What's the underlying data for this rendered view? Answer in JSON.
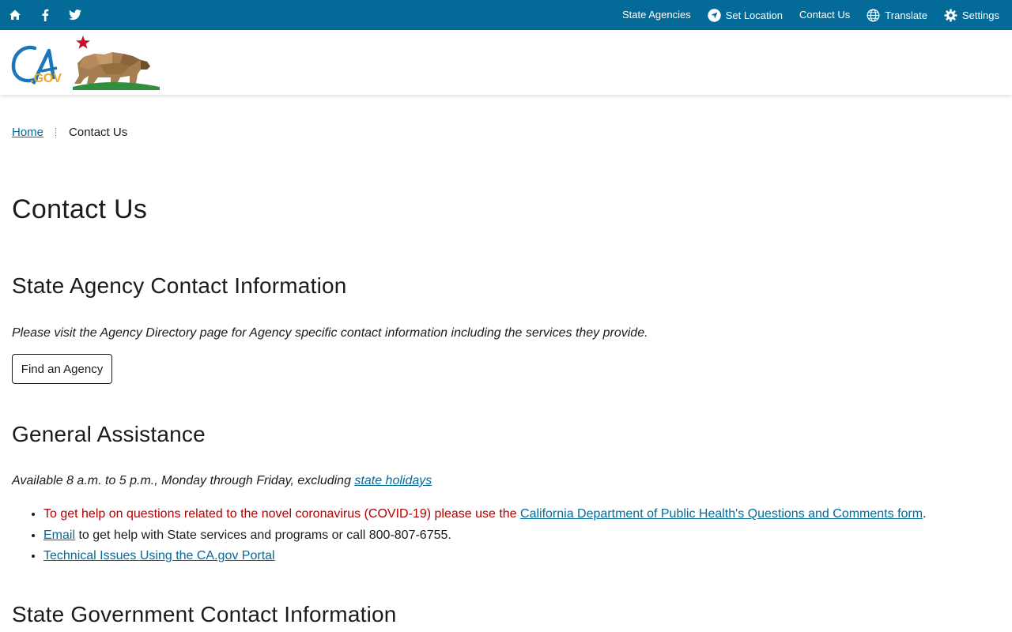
{
  "utility": {
    "icons": [
      "home-icon",
      "facebook-icon",
      "twitter-icon"
    ],
    "links": {
      "state_agencies": "State Agencies",
      "set_location": "Set Location",
      "contact_us": "Contact Us",
      "translate": "Translate",
      "settings": "Settings"
    }
  },
  "branding": {
    "logo_text": "CA.GOV"
  },
  "breadcrumb": {
    "home": "Home",
    "current": "Contact Us"
  },
  "page": {
    "title": "Contact Us"
  },
  "agency_section": {
    "heading": "State Agency Contact Information",
    "intro": "Please visit the Agency Directory page for Agency specific contact information including the services they provide.",
    "button": "Find an Agency"
  },
  "general_section": {
    "heading": "General Assistance",
    "hours_prefix": "Available 8 a.m. to 5 p.m., Monday through Friday, excluding ",
    "hours_link": "state holidays",
    "items": [
      {
        "text": "To get help on questions related to the novel coronavirus (COVID-19) please use the ",
        "link": "California Department of Public Health's Questions and Comments form",
        "suffix": "."
      },
      {
        "link": "Email",
        "text": " to get help with State services and programs or call 800-807-6755."
      },
      {
        "link": "Technical Issues Using the CA.gov Portal"
      }
    ]
  },
  "state_section": {
    "heading": "State Government Contact Information"
  },
  "colors": {
    "utility_bar": "#046b99",
    "link": "#046b99",
    "alert_text": "#b00000"
  }
}
